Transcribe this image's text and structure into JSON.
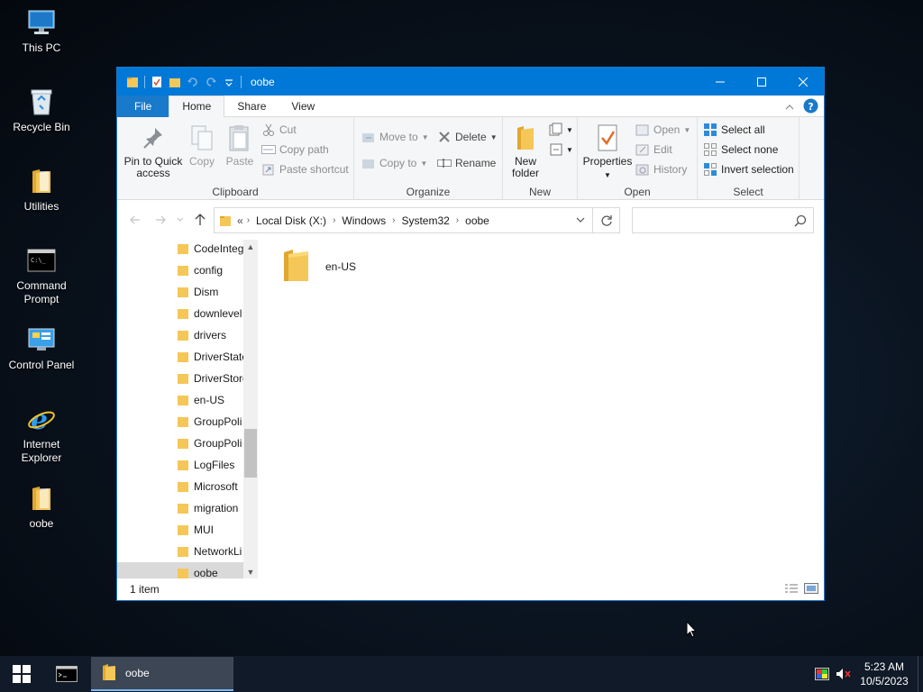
{
  "desktop": {
    "icons": [
      {
        "label": "This PC"
      },
      {
        "label": "Recycle Bin"
      },
      {
        "label": "Utilities"
      },
      {
        "label": "Command Prompt"
      },
      {
        "label": "Control Panel"
      },
      {
        "label": "Internet Explorer"
      },
      {
        "label": "oobe"
      }
    ]
  },
  "window": {
    "title": "oobe",
    "ribbon_tabs": {
      "file": "File",
      "home": "Home",
      "share": "Share",
      "view": "View"
    },
    "ribbon": {
      "clipboard": {
        "label": "Clipboard",
        "pin": "Pin to Quick access",
        "copy": "Copy",
        "paste": "Paste",
        "cut": "Cut",
        "copy_path": "Copy path",
        "paste_shortcut": "Paste shortcut"
      },
      "organize": {
        "label": "Organize",
        "move_to": "Move to",
        "copy_to": "Copy to",
        "delete": "Delete",
        "rename": "Rename"
      },
      "new": {
        "label": "New",
        "new_folder": "New folder"
      },
      "open": {
        "label": "Open",
        "properties": "Properties",
        "open": "Open",
        "edit": "Edit",
        "history": "History"
      },
      "select": {
        "label": "Select",
        "select_all": "Select all",
        "select_none": "Select none",
        "invert": "Invert selection"
      }
    },
    "address": {
      "overflow": "«",
      "crumbs": [
        "Local Disk (X:)",
        "Windows",
        "System32",
        "oobe"
      ]
    },
    "search": {
      "placeholder": ""
    },
    "nav_items": [
      "CodeInteg",
      "config",
      "Dism",
      "downlevel",
      "drivers",
      "DriverState",
      "DriverStore",
      "en-US",
      "GroupPoli",
      "GroupPoli",
      "LogFiles",
      "Microsoft",
      "migration",
      "MUI",
      "NetworkLi",
      "oobe"
    ],
    "files": [
      {
        "name": "en-US"
      }
    ],
    "status": "1 item"
  },
  "taskbar": {
    "task_label": "oobe",
    "time": "5:23 AM",
    "date": "10/5/2023"
  },
  "colors": {
    "accent": "#0078d7",
    "folder": "#f5c758",
    "taskbar": "#101a28"
  }
}
